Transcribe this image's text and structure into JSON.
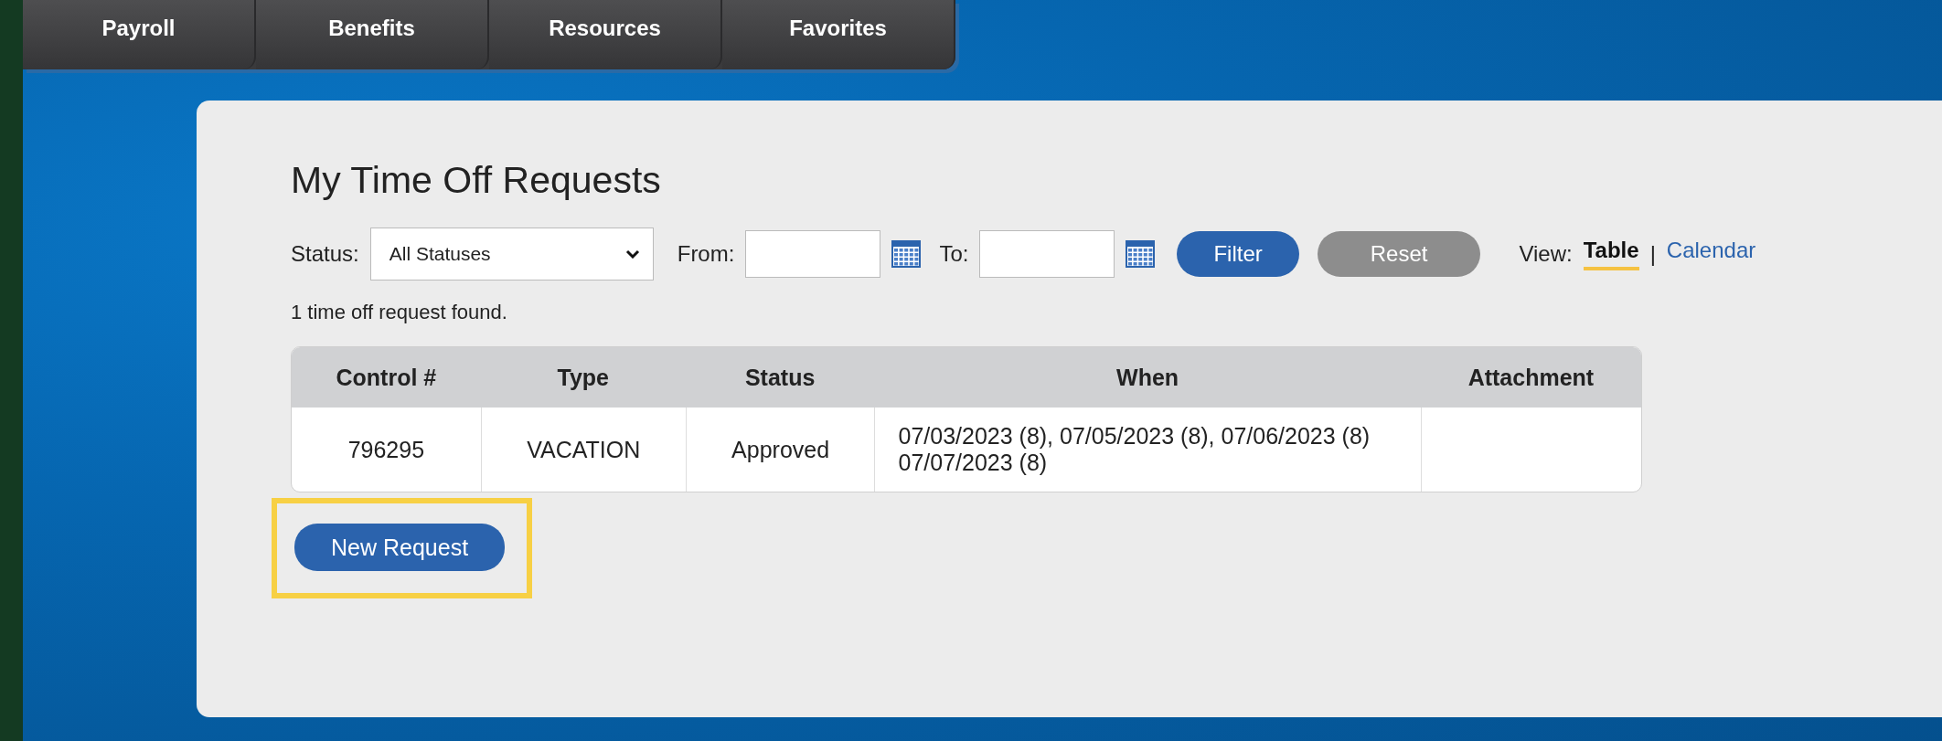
{
  "nav_tabs": [
    {
      "label": "Payroll"
    },
    {
      "label": "Benefits"
    },
    {
      "label": "Resources"
    },
    {
      "label": "Favorites"
    }
  ],
  "page_title": "My Time Off Requests",
  "filters": {
    "status_label": "Status:",
    "status_value": "All Statuses",
    "from_label": "From:",
    "to_label": "To:",
    "filter_button": "Filter",
    "reset_button": "Reset"
  },
  "view": {
    "label": "View:",
    "separator": "|",
    "options": [
      {
        "label": "Table",
        "selected": true
      },
      {
        "label": "Calendar",
        "selected": false
      }
    ]
  },
  "result_count": "1 time off request found.",
  "table": {
    "columns": [
      "Control #",
      "Type",
      "Status",
      "When",
      "Attachment"
    ],
    "rows": [
      {
        "cells": [
          "796295",
          "VACATION",
          "Approved",
          "07/03/2023 (8), 07/05/2023 (8), 07/06/2023 (8) 07/07/2023 (8)",
          ""
        ]
      }
    ]
  },
  "new_request_button": {
    "label": "New Request",
    "highlighted": true
  }
}
